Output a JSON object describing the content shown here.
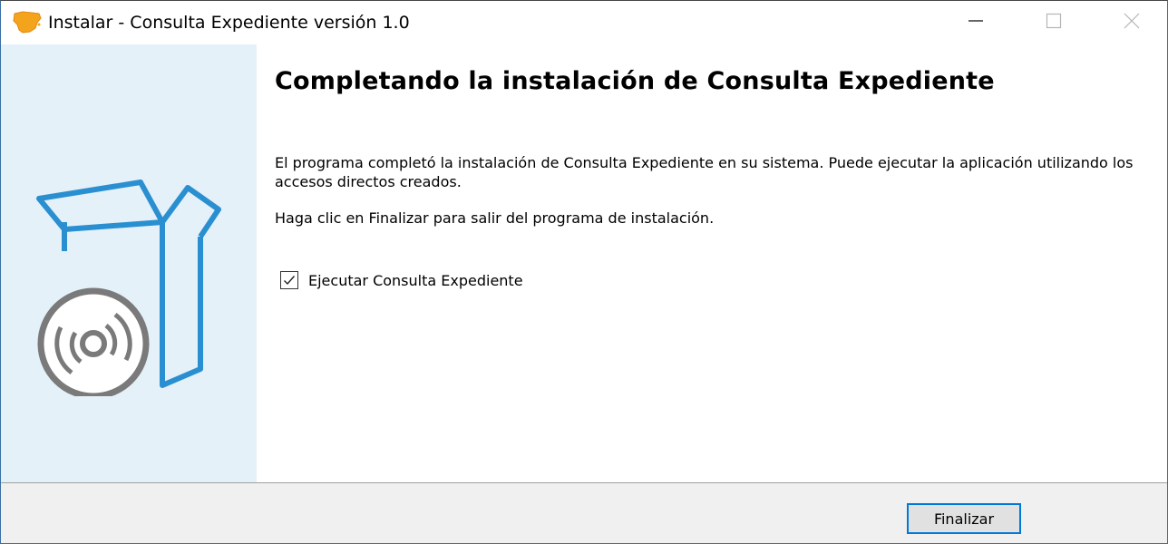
{
  "window": {
    "title": "Instalar - Consulta Expediente versión 1.0",
    "icon": "spain-map-icon",
    "controls": {
      "minimize_icon": "minimize-icon",
      "maximize_icon": "maximize-icon",
      "close_icon": "close-icon"
    }
  },
  "wizard": {
    "heading": "Completando la instalación de Consulta Expediente",
    "paragraph1": "El programa completó la instalación de Consulta Expediente en su sistema. Puede ejecutar la aplicación utilizando los accesos directos creados.",
    "paragraph2": "Haga clic en Finalizar para salir del programa de instalación.",
    "run_checkbox": {
      "label": "Ejecutar Consulta Expediente",
      "checked": true
    },
    "side_art_icon": "install-box-disc-icon"
  },
  "footer": {
    "finish_label": "Finalizar"
  },
  "colors": {
    "side_panel": "#e4f1f9",
    "box_blue": "#2a8fd0",
    "disc_gray": "#7a7a7a",
    "accent_border": "#0078d7",
    "footer_bg": "#f0f0f0"
  }
}
